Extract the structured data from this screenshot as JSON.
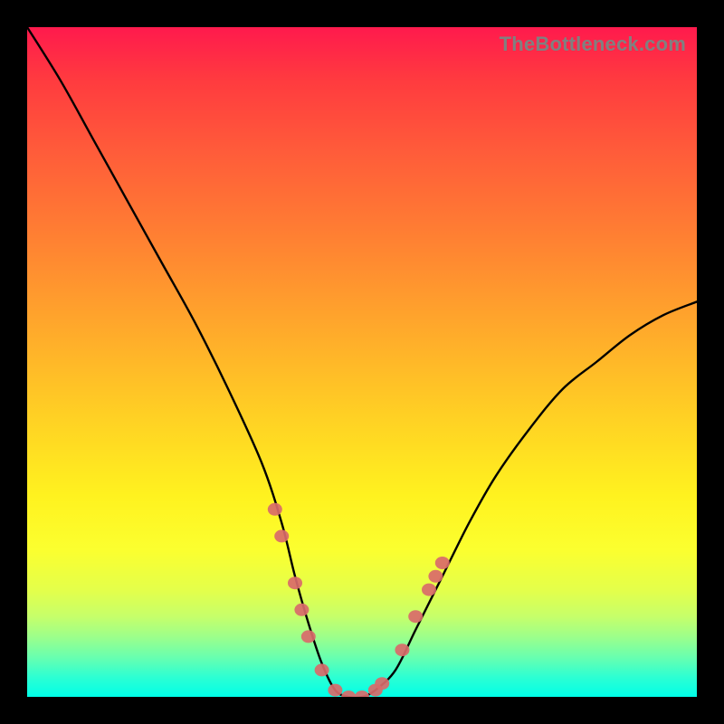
{
  "watermark": "TheBottleneck.com",
  "chart_data": {
    "type": "line",
    "title": "",
    "xlabel": "",
    "ylabel": "",
    "xlim": [
      0,
      100
    ],
    "ylim": [
      0,
      100
    ],
    "series": [
      {
        "name": "bottleneck-curve",
        "x": [
          0,
          5,
          10,
          15,
          20,
          25,
          30,
          35,
          38,
          40,
          42,
          44,
          46,
          48,
          50,
          52,
          55,
          58,
          62,
          66,
          70,
          75,
          80,
          85,
          90,
          95,
          100
        ],
        "y": [
          100,
          92,
          83,
          74,
          65,
          56,
          46,
          35,
          26,
          18,
          11,
          5,
          1,
          0,
          0,
          1,
          4,
          10,
          18,
          26,
          33,
          40,
          46,
          50,
          54,
          57,
          59
        ]
      }
    ],
    "highlight_points": {
      "name": "curve-markers",
      "color": "#d96a6a",
      "points": [
        {
          "x": 37,
          "y": 28
        },
        {
          "x": 38,
          "y": 24
        },
        {
          "x": 40,
          "y": 17
        },
        {
          "x": 41,
          "y": 13
        },
        {
          "x": 42,
          "y": 9
        },
        {
          "x": 44,
          "y": 4
        },
        {
          "x": 46,
          "y": 1
        },
        {
          "x": 48,
          "y": 0
        },
        {
          "x": 50,
          "y": 0
        },
        {
          "x": 52,
          "y": 1
        },
        {
          "x": 53,
          "y": 2
        },
        {
          "x": 56,
          "y": 7
        },
        {
          "x": 58,
          "y": 12
        },
        {
          "x": 60,
          "y": 16
        },
        {
          "x": 61,
          "y": 18
        },
        {
          "x": 62,
          "y": 20
        }
      ]
    }
  }
}
